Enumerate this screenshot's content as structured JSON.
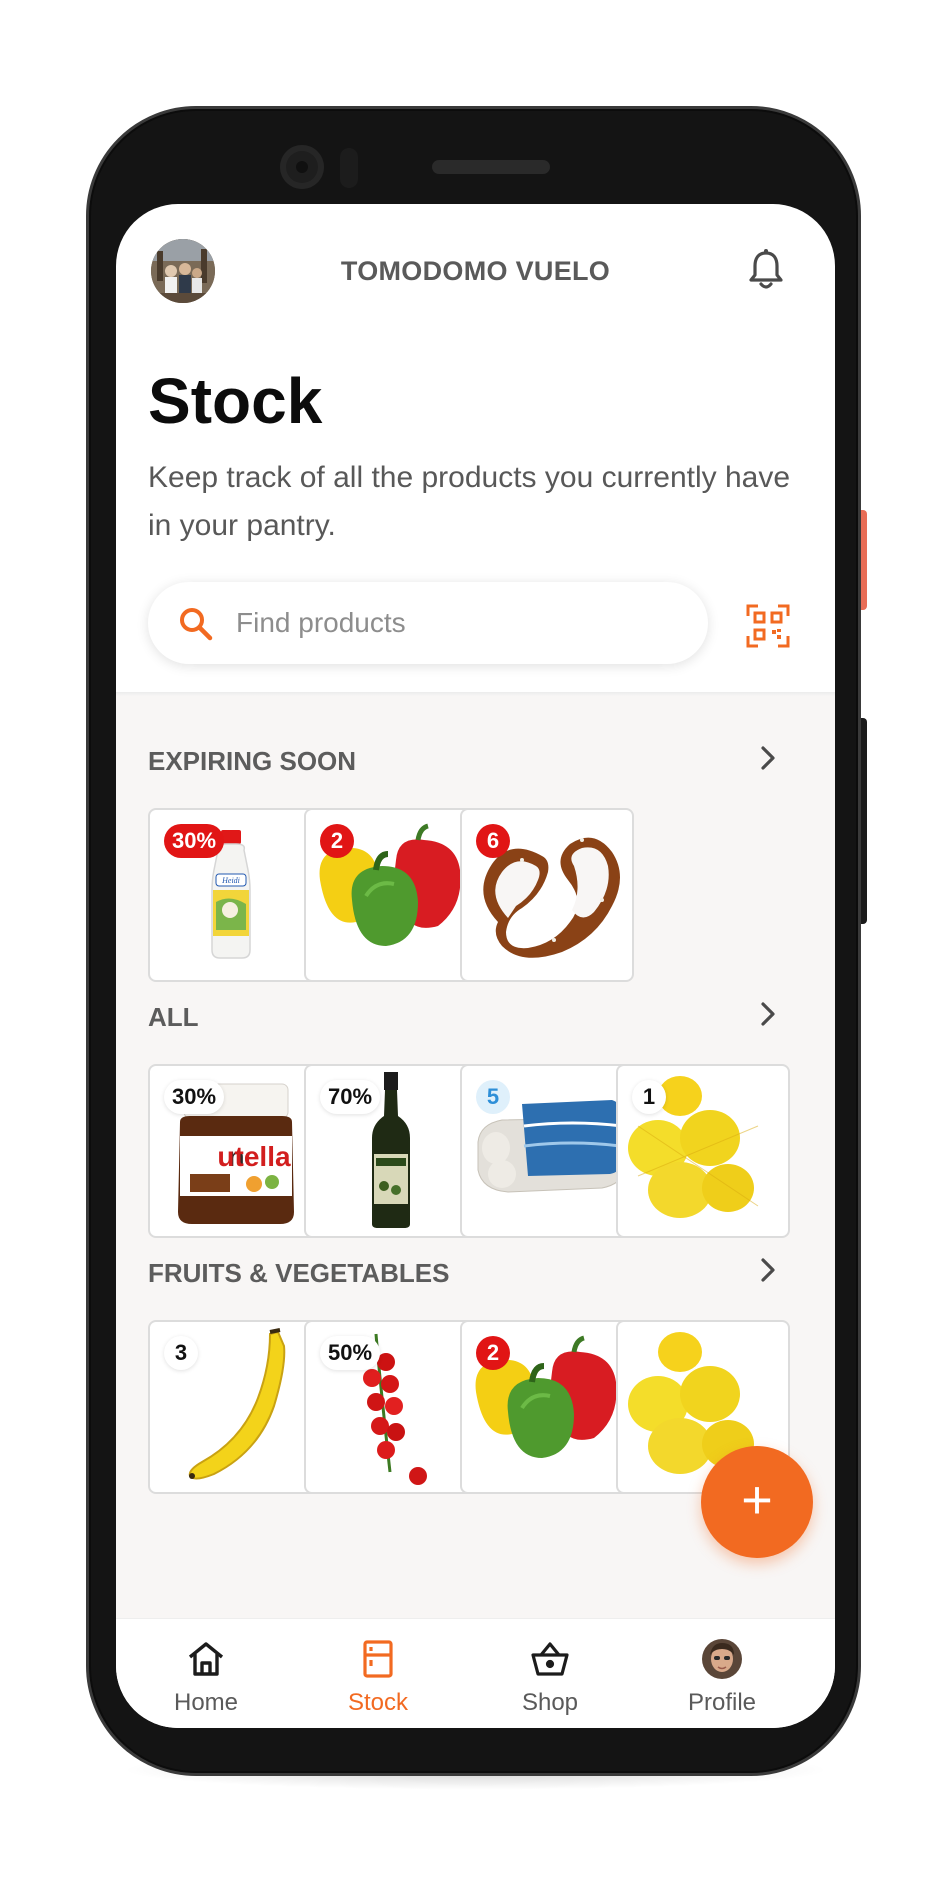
{
  "header": {
    "org_name": "TOMODOMO VUELO",
    "bell_icon": "bell-icon"
  },
  "page": {
    "title": "Stock",
    "subtitle": "Keep track of all the products you currently have in your pantry."
  },
  "search": {
    "placeholder": "Find products",
    "icon": "search-icon",
    "scan_icon": "qr-scan-icon"
  },
  "colors": {
    "accent": "#f26a21",
    "badge_red": "#e11515",
    "badge_blue": "#2e8fd8"
  },
  "sections": [
    {
      "title": "EXPIRING SOON",
      "items": [
        {
          "product": "milk",
          "badge": "30%",
          "badge_style": "red"
        },
        {
          "product": "peppers",
          "badge": "2",
          "badge_style": "red"
        },
        {
          "product": "pretzel",
          "badge": "6",
          "badge_style": "red"
        }
      ]
    },
    {
      "title": "ALL",
      "items": [
        {
          "product": "nutella",
          "badge": "30%",
          "badge_style": "white"
        },
        {
          "product": "olive-oil",
          "badge": "70%",
          "badge_style": "white"
        },
        {
          "product": "eggs",
          "badge": "5",
          "badge_style": "blue"
        },
        {
          "product": "lemons",
          "badge": "1",
          "badge_style": "white"
        }
      ]
    },
    {
      "title": "FRUITS & VEGETABLES",
      "items": [
        {
          "product": "banana",
          "badge": "3",
          "badge_style": "white"
        },
        {
          "product": "tomatoes",
          "badge": "50%",
          "badge_style": "white"
        },
        {
          "product": "peppers",
          "badge": "2",
          "badge_style": "red"
        },
        {
          "product": "lemons",
          "badge": "",
          "badge_style": "none"
        }
      ]
    }
  ],
  "fab": {
    "label": "+"
  },
  "nav": [
    {
      "label": "Home",
      "icon": "home-icon",
      "active": false
    },
    {
      "label": "Stock",
      "icon": "fridge-icon",
      "active": true
    },
    {
      "label": "Shop",
      "icon": "basket-icon",
      "active": false
    },
    {
      "label": "Profile",
      "icon": "profile-avatar",
      "active": false
    }
  ]
}
